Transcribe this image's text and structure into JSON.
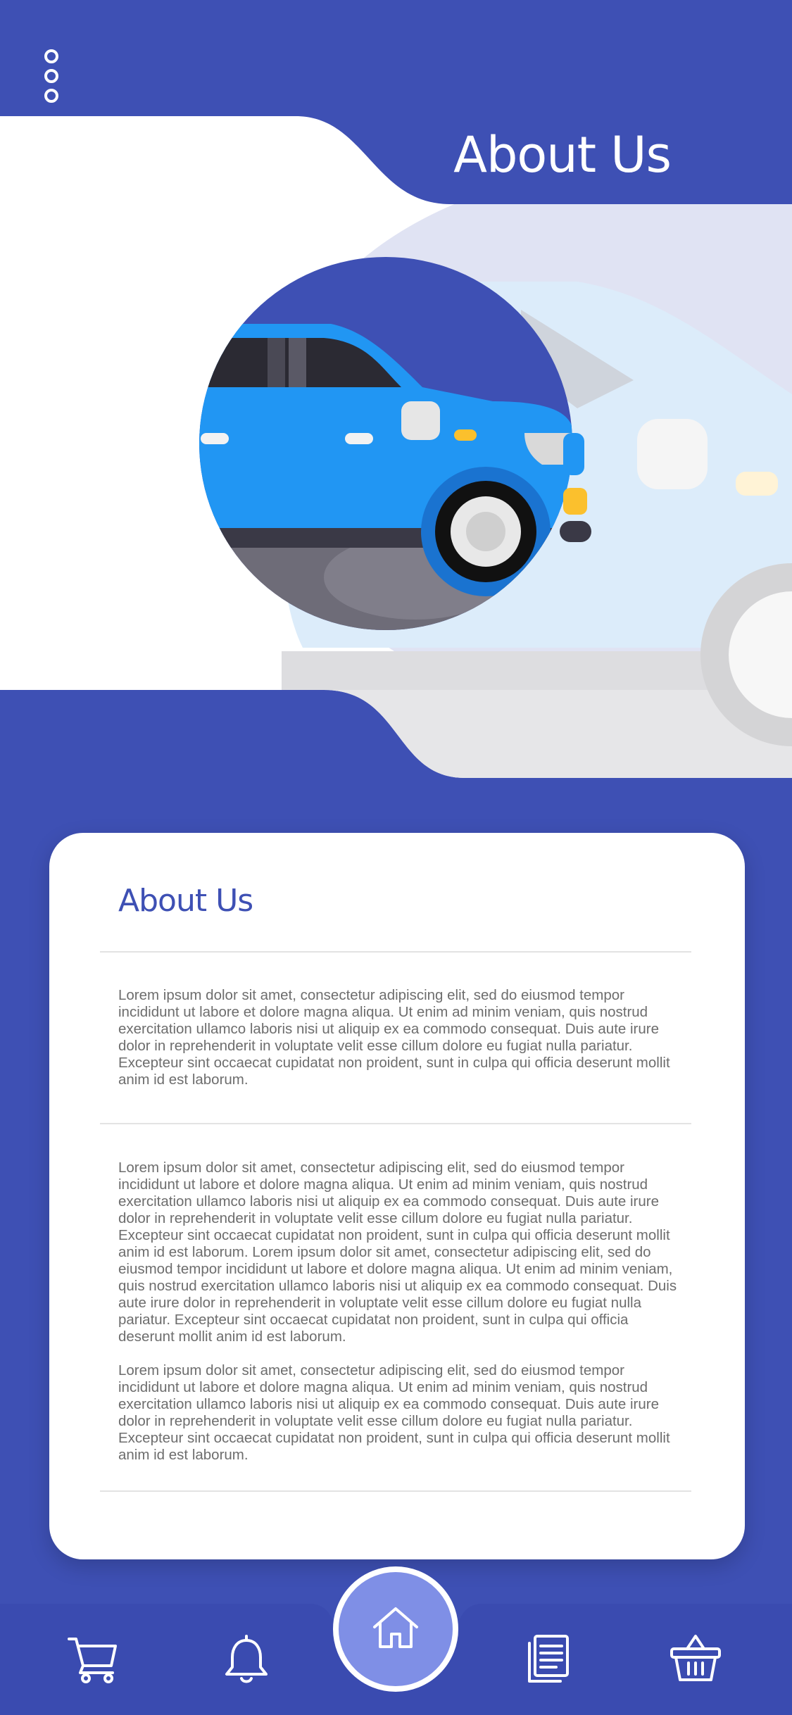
{
  "header": {
    "title": "About Us",
    "menu_icon": "more-vertical-icon"
  },
  "card": {
    "title": "About Us",
    "paragraphs": [
      "Lorem ipsum dolor sit amet, consectetur adipiscing elit, sed do eiusmod tempor incididunt ut labore et dolore magna aliqua. Ut enim ad minim veniam, quis nostrud exercitation ullamco laboris nisi ut aliquip ex ea commodo consequat. Duis aute irure dolor in reprehenderit in voluptate velit esse cillum dolore eu fugiat nulla pariatur. Excepteur sint occaecat cupidatat non proident, sunt in culpa qui officia deserunt mollit anim id est laborum.",
      "Lorem ipsum dolor sit amet, consectetur adipiscing elit, sed do eiusmod tempor incididunt ut labore et dolore magna aliqua. Ut enim ad minim veniam, quis nostrud exercitation ullamco laboris nisi ut aliquip ex ea commodo consequat. Duis aute irure dolor in reprehenderit in voluptate velit esse cillum dolore eu fugiat nulla pariatur. Excepteur sint occaecat cupidatat non proident, sunt in culpa qui officia deserunt mollit anim id est laborum. Lorem ipsum dolor sit amet, consectetur adipiscing elit, sed do eiusmod tempor incididunt ut labore et dolore magna aliqua. Ut enim ad minim veniam, quis nostrud exercitation ullamco laboris nisi ut aliquip ex ea commodo consequat. Duis aute irure dolor in reprehenderit in voluptate velit esse cillum dolore eu fugiat nulla pariatur. Excepteur sint occaecat cupidatat non proident, sunt in culpa qui officia deserunt mollit anim id est laborum.",
      "Lorem ipsum dolor sit amet, consectetur adipiscing elit, sed do eiusmod tempor incididunt ut labore et dolore magna aliqua. Ut enim ad minim veniam, quis nostrud exercitation ullamco laboris nisi ut aliquip ex ea commodo consequat. Duis aute irure dolor in reprehenderit in voluptate velit esse cillum dolore eu fugiat nulla pariatur. Excepteur sint occaecat cupidatat non proident, sunt in culpa qui officia deserunt mollit anim id est laborum."
    ]
  },
  "nav": {
    "items": [
      {
        "icon": "cart-icon"
      },
      {
        "icon": "bell-icon"
      },
      {
        "icon": "home-icon",
        "active": true
      },
      {
        "icon": "documents-icon"
      },
      {
        "icon": "basket-icon"
      }
    ]
  },
  "colors": {
    "primary": "#3e50b4",
    "home_button": "#7f8fe6",
    "card_title": "#3e50b4",
    "body_text": "#6d6d6d",
    "car_blue": "#2196f3",
    "hero_tint": "#e0e3f3"
  }
}
